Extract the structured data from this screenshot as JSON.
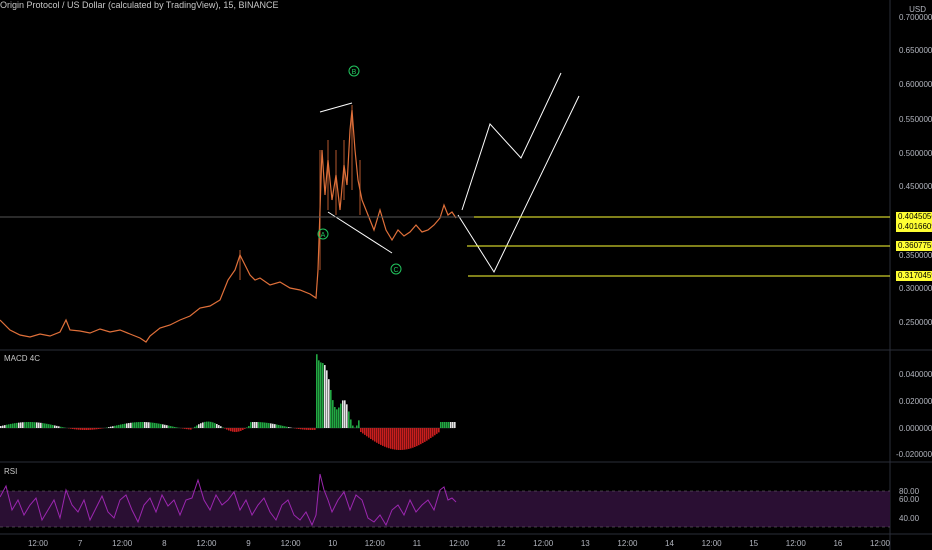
{
  "header": {
    "title": "Origin Protocol / US Dollar (calculated by TradingView), 15, BINANCE",
    "currency": "USD"
  },
  "colors": {
    "background": "#000000",
    "candle": "#e0703a",
    "wave_line": "#ffffff",
    "label_green": "#22c55e",
    "horizontal_level": "#ffff33",
    "macd_green": "#22a843",
    "macd_white": "#e6e6e6",
    "macd_red": "#c81e1e",
    "rsi_line": "#9c27b0",
    "rsi_band": "#2a0f33"
  },
  "panes": {
    "macd_label": "MACD 4C",
    "rsi_label": "RSI"
  },
  "price_axis": {
    "ticks": [
      "0.70000000",
      "0.65000000",
      "0.60000000",
      "0.55000000",
      "0.50000000",
      "0.45000000",
      "0.35000000",
      "0.30000000",
      "0.25000000"
    ],
    "level_tags": [
      "0.40450560",
      "0.40166095",
      "0.36077556",
      "0.31704593"
    ]
  },
  "macd_axis": {
    "ticks": [
      "0.04000000",
      "0.02000000",
      "0.00000000",
      "-0.02000000"
    ]
  },
  "rsi_axis": {
    "ticks": [
      "80.00",
      "60.00",
      "40.00"
    ]
  },
  "time_axis": {
    "ticks": [
      "12:00",
      "7",
      "12:00",
      "8",
      "12:00",
      "9",
      "12:00",
      "10",
      "12:00",
      "11",
      "12:00",
      "12",
      "12:00",
      "13",
      "12:00",
      "14",
      "12:00",
      "15",
      "12:00",
      "16",
      "12:00"
    ]
  },
  "wave_labels": {
    "a": "A",
    "b": "B",
    "c": "C"
  },
  "chart_data": {
    "type": "line",
    "title": "Origin Protocol / US Dollar (calculated by TradingView), 15, BINANCE",
    "xlabel": "",
    "ylabel": "USD",
    "ylim": [
      0.2,
      0.72
    ],
    "x": [
      "12:00",
      "7",
      "12:00",
      "8",
      "12:00",
      "9",
      "12:00",
      "10",
      "12:00",
      "11",
      "12:00"
    ],
    "series": [
      {
        "values": [
          0.245,
          0.23,
          0.235,
          0.24,
          0.22,
          0.26,
          0.35,
          0.3,
          0.29,
          0.56,
          0.42,
          0.39,
          0.405
        ]
      }
    ],
    "levels": [
      0.4045056,
      0.40166095,
      0.36077556,
      0.31704593
    ]
  }
}
